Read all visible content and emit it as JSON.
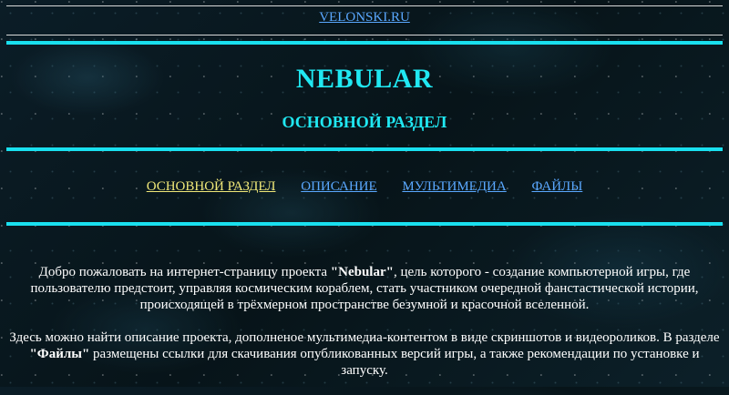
{
  "header": {
    "top_link": "VELONSKI.RU",
    "site_title": "NEBULAR",
    "section_title": "ОСНОВНОЙ РАЗДЕЛ"
  },
  "nav": {
    "items": [
      {
        "label": "ОСНОВНОЙ РАЗДЕЛ",
        "active": true
      },
      {
        "label": "ОПИСАНИЕ",
        "active": false
      },
      {
        "label": "МУЛЬТИМЕДИА",
        "active": false
      },
      {
        "label": "ФАЙЛЫ",
        "active": false
      }
    ]
  },
  "content": {
    "p1_before": "Добро пожаловать на интернет-страницу проекта ",
    "p1_bold": "\"Nebular\"",
    "p1_after": ", цель которого - создание компьютерной игры, где пользователю предстоит, управляя космическим кораблем, стать участником очередной фанстастической истории, происходящей в трёхмерном пространстве безумной и красочной вселенной.",
    "p2_before": "Здесь можно найти описание проекта, дополненое мультимедиа-контентом в виде скриншотов и видеороликов. В разделе ",
    "p2_bold": "\"Файлы\"",
    "p2_after": " размещены ссылки для скачивания опубликованных версий игры, а также рекомендации по установке и запуску."
  },
  "colors": {
    "accent": "#19e0ef",
    "link": "#5aa8ff",
    "active_link": "#f0e878",
    "rule_thin": "#d8d8d8"
  }
}
